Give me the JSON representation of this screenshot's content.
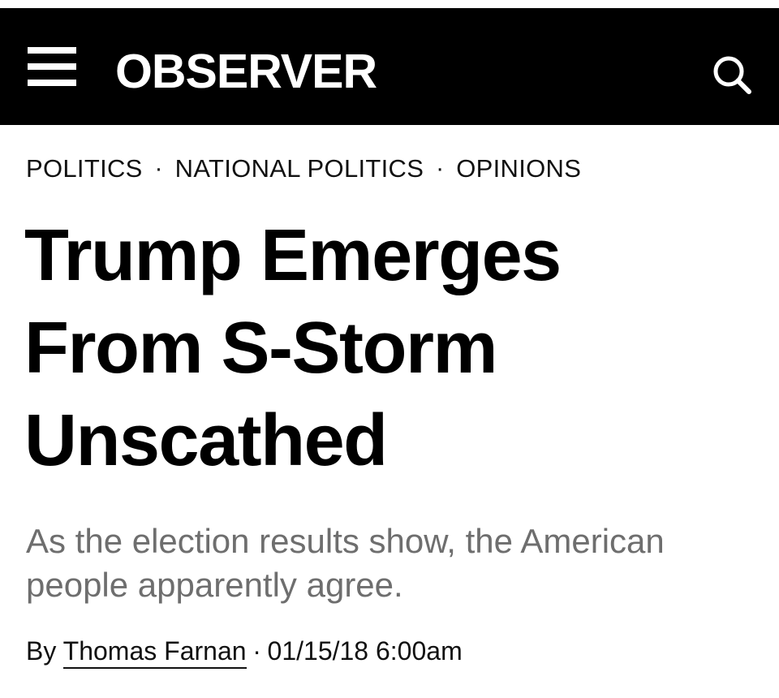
{
  "header": {
    "logo": "OBSERVER",
    "menu_icon": "hamburger-menu-icon",
    "search_icon": "search-icon",
    "background_color": "#000000",
    "foreground_color": "#ffffff"
  },
  "breadcrumb": {
    "items": [
      {
        "label": "POLITICS"
      },
      {
        "label": "NATIONAL POLITICS"
      },
      {
        "label": "OPINIONS"
      }
    ],
    "separator": "·"
  },
  "article": {
    "headline": "Trump Emerges From S-Storm Unscathed",
    "subhead": "As the election results show, the American people apparently agree.",
    "subhead_color": "#6e6e6e",
    "byline_prefix": "By",
    "author": "Thomas Farnan",
    "byline_separator": "·",
    "timestamp": "01/15/18 6:00am"
  }
}
